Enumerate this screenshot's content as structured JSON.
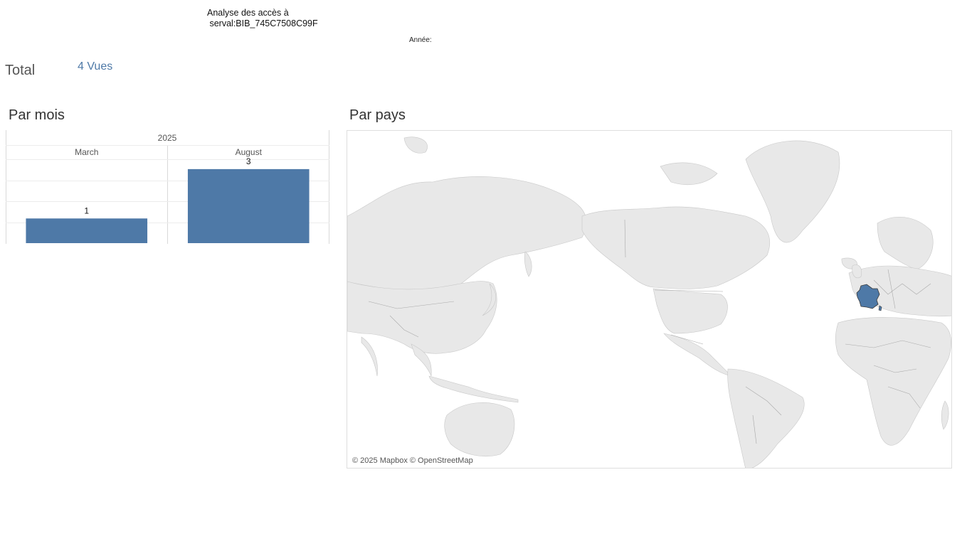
{
  "header": {
    "title": "Analyse des accès à\n serval:BIB_745C7508C99F",
    "year_filter_label": "Année:"
  },
  "total": {
    "label": "Total",
    "value": "4 Vues"
  },
  "per_month": {
    "title": "Par mois"
  },
  "per_country": {
    "title": "Par pays",
    "highlighted_country": "France",
    "highlight_color": "#4e79a7",
    "attribution": "© 2025 Mapbox © OpenStreetMap"
  },
  "chart_data": {
    "type": "bar",
    "column_header": "2025",
    "categories": [
      "March",
      "August"
    ],
    "values": [
      1,
      3
    ],
    "bar_color": "#4e79a7",
    "ylim": [
      0,
      3.4
    ],
    "grid": true
  }
}
